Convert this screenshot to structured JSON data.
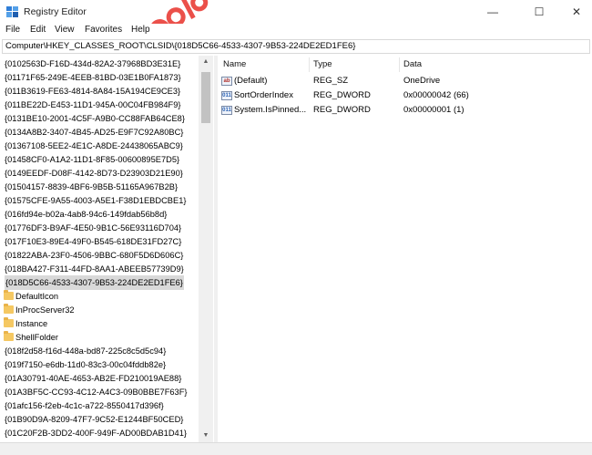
{
  "window": {
    "title": "Registry Editor",
    "minimize_glyph": "—",
    "maximize_glyph": "☐",
    "close_glyph": "✕"
  },
  "menu": [
    "File",
    "Edit",
    "View",
    "Favorites",
    "Help"
  ],
  "address": "Computer\\HKEY_CLASSES_ROOT\\CLSID\\{018D5C66-4533-4307-9B53-224DE2ED1FE6}",
  "tree": {
    "items": [
      {
        "label": "{0102563D-F16D-434d-82A2-37968BD3E31E}",
        "kind": "key"
      },
      {
        "label": "{01171F65-249E-4EEB-81BD-03E1B0FA1873}",
        "kind": "key"
      },
      {
        "label": "{011B3619-FE63-4814-8A84-15A194CE9CE3}",
        "kind": "key"
      },
      {
        "label": "{011BE22D-E453-11D1-945A-00C04FB984F9}",
        "kind": "key"
      },
      {
        "label": "{0131BE10-2001-4C5F-A9B0-CC88FAB64CE8}",
        "kind": "key"
      },
      {
        "label": "{0134A8B2-3407-4B45-AD25-E9F7C92A80BC}",
        "kind": "key"
      },
      {
        "label": "{01367108-5EE2-4E1C-A8DE-24438065ABC9}",
        "kind": "key"
      },
      {
        "label": "{01458CF0-A1A2-11D1-8F85-00600895E7D5}",
        "kind": "key"
      },
      {
        "label": "{0149EEDF-D08F-4142-8D73-D23903D21E90}",
        "kind": "key"
      },
      {
        "label": "{01504157-8839-4BF6-9B5B-51165A967B2B}",
        "kind": "key"
      },
      {
        "label": "{01575CFE-9A55-4003-A5E1-F38D1EBDCBE1}",
        "kind": "key"
      },
      {
        "label": "{016fd94e-b02a-4ab8-94c6-149fdab56b8d}",
        "kind": "key"
      },
      {
        "label": "{01776DF3-B9AF-4E50-9B1C-56E93116D704}",
        "kind": "key"
      },
      {
        "label": "{017F10E3-89E4-49F0-B545-618DE31FD27C}",
        "kind": "key"
      },
      {
        "label": "{01822ABA-23F0-4506-9BBC-680F5D6D606C}",
        "kind": "key"
      },
      {
        "label": "{018BA427-F311-44FD-8AA1-ABEEB57739D9}",
        "kind": "key"
      },
      {
        "label": "{018D5C66-4533-4307-9B53-224DE2ED1FE6}",
        "kind": "key",
        "selected": true
      },
      {
        "label": "DefaultIcon",
        "kind": "folder"
      },
      {
        "label": "InProcServer32",
        "kind": "folder"
      },
      {
        "label": "Instance",
        "kind": "folder"
      },
      {
        "label": "ShellFolder",
        "kind": "folder"
      },
      {
        "label": "{018f2d58-f16d-448a-bd87-225c8c5d5c94}",
        "kind": "key"
      },
      {
        "label": "{019f7150-e6db-11d0-83c3-00c04fddb82e}",
        "kind": "key"
      },
      {
        "label": "{01A30791-40AE-4653-AB2E-FD210019AE88}",
        "kind": "key"
      },
      {
        "label": "{01A3BF5C-CC93-4C12-A4C3-09B0BBE7F63F}",
        "kind": "key"
      },
      {
        "label": "{01afc156-f2eb-4c1c-a722-8550417d396f}",
        "kind": "key"
      },
      {
        "label": "{01B90D9A-8209-47F7-9C52-E1244BF50CED}",
        "kind": "key"
      },
      {
        "label": "{01C20F2B-3DD2-400F-949F-AD00BDAB1D41}",
        "kind": "key"
      }
    ]
  },
  "values_pane": {
    "columns": [
      "Name",
      "Type",
      "Data"
    ],
    "rows": [
      {
        "name": "(Default)",
        "type": "REG_SZ",
        "data": "OneDrive",
        "icon": "string-value-icon",
        "icon_glyph": "ab"
      },
      {
        "name": "SortOrderIndex",
        "type": "REG_DWORD",
        "data": "0x00000042 (66)",
        "icon": "dword-value-icon",
        "icon_glyph": "011"
      },
      {
        "name": "System.IsPinned...",
        "type": "REG_DWORD",
        "data": "0x00000001 (1)",
        "icon": "dword-value-icon",
        "icon_glyph": "011"
      }
    ]
  },
  "scrollbar": {
    "up_glyph": "▲",
    "down_glyph": "▼"
  },
  "colors": {
    "selection": "#d9d9d9",
    "folder": "#f5c862",
    "watermark": "#e8322b"
  }
}
